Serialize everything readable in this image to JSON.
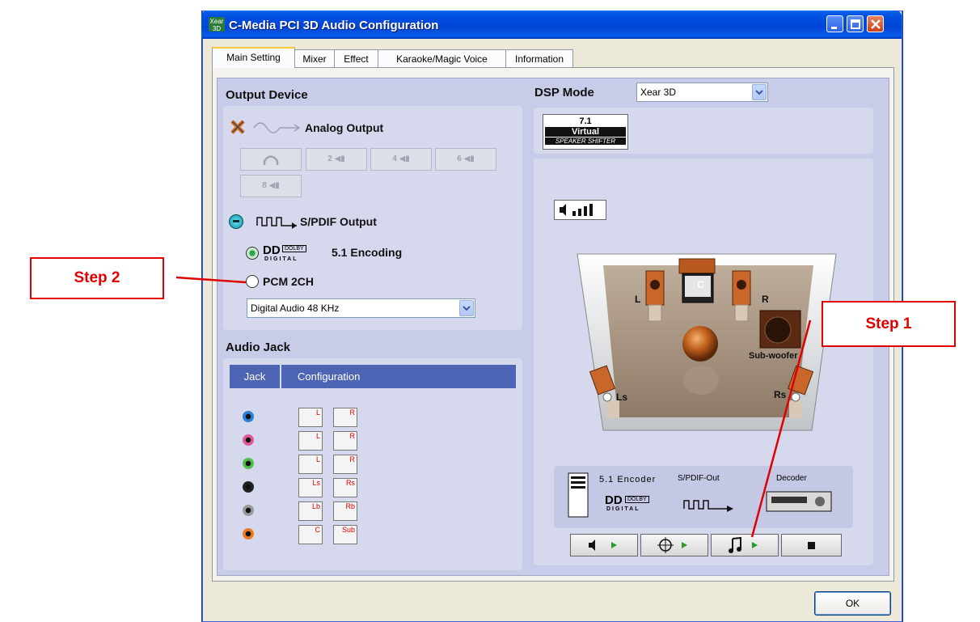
{
  "window": {
    "title": "C-Media PCI 3D Audio Configuration",
    "app_icon_text": "Xear 3D"
  },
  "tabs": [
    {
      "label": "Main Setting",
      "active": true
    },
    {
      "label": "Mixer",
      "active": false
    },
    {
      "label": "Effect",
      "active": false
    },
    {
      "label": "Karaoke/Magic Voice",
      "active": false
    },
    {
      "label": "Information",
      "active": false
    }
  ],
  "output_device": {
    "heading": "Output Device",
    "analog_label": "Analog Output",
    "analog_buttons": [
      "2",
      "4",
      "6",
      "8"
    ],
    "spdif_label": "S/PDIF Output",
    "encoding_label": "5.1 Encoding",
    "dolby_badge": "DOLBY",
    "digital_text": "DIGITAL",
    "pcm_label": "PCM 2CH",
    "sample_rate_value": "Digital Audio 48 KHz"
  },
  "dsp": {
    "label": "DSP Mode",
    "value": "Xear 3D",
    "badge_line1": "7.1",
    "badge_line2": "Virtual",
    "badge_line3": "SPEAKER SHIFTER"
  },
  "speakers": {
    "center": "C",
    "left": "L",
    "right": "R",
    "sub": "Sub-woofer",
    "left_surround": "Ls",
    "right_surround": "Rs"
  },
  "encoder_panel": {
    "encoder_label": "5.1 Encoder",
    "spdif_out_label": "S/PDIF-Out",
    "decoder_label": "Decoder"
  },
  "audio_jack": {
    "heading": "Audio Jack",
    "col_jack": "Jack",
    "col_config": "Configuration",
    "rows": [
      {
        "color": "#2a7fd4",
        "left": "L",
        "right": "R"
      },
      {
        "color": "#e05a9a",
        "left": "L",
        "right": "R"
      },
      {
        "color": "#4fc04a",
        "left": "L",
        "right": "R"
      },
      {
        "color": "#222222",
        "left": "Ls",
        "right": "Rs"
      },
      {
        "color": "#9a9a9a",
        "left": "Lb",
        "right": "Rb"
      },
      {
        "color": "#ee7a20",
        "left": "C",
        "right": "Sub"
      }
    ]
  },
  "annotations": {
    "step1": "Step 1",
    "step2": "Step 2"
  },
  "footer": {
    "ok_label": "OK"
  }
}
